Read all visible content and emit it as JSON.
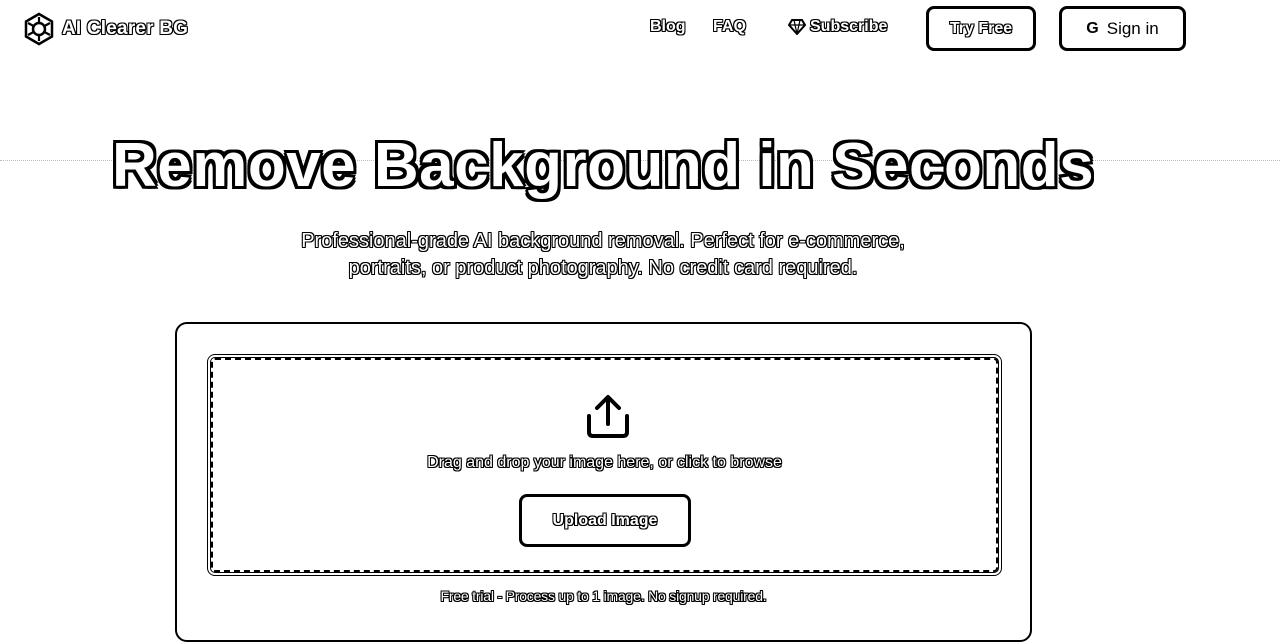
{
  "header": {
    "brand": "AI Clearer BG",
    "nav": {
      "blog": "Blog",
      "faq": "FAQ",
      "subscribe": "Subscribe"
    },
    "try_free": "Try Free",
    "sign_in": "Sign in",
    "sign_in_icon": "G"
  },
  "hero": {
    "title": "Remove Background in Seconds",
    "subtitle_line1": "Professional-grade AI background removal. Perfect for e-commerce,",
    "subtitle_line2": "portraits, or product photography. No credit card required."
  },
  "upload": {
    "icon": "upload-icon",
    "instruction": "Drag and drop your image here, or click to browse",
    "button": "Upload Image",
    "note": "Free trial - Process up to 1 image. No signup required."
  }
}
